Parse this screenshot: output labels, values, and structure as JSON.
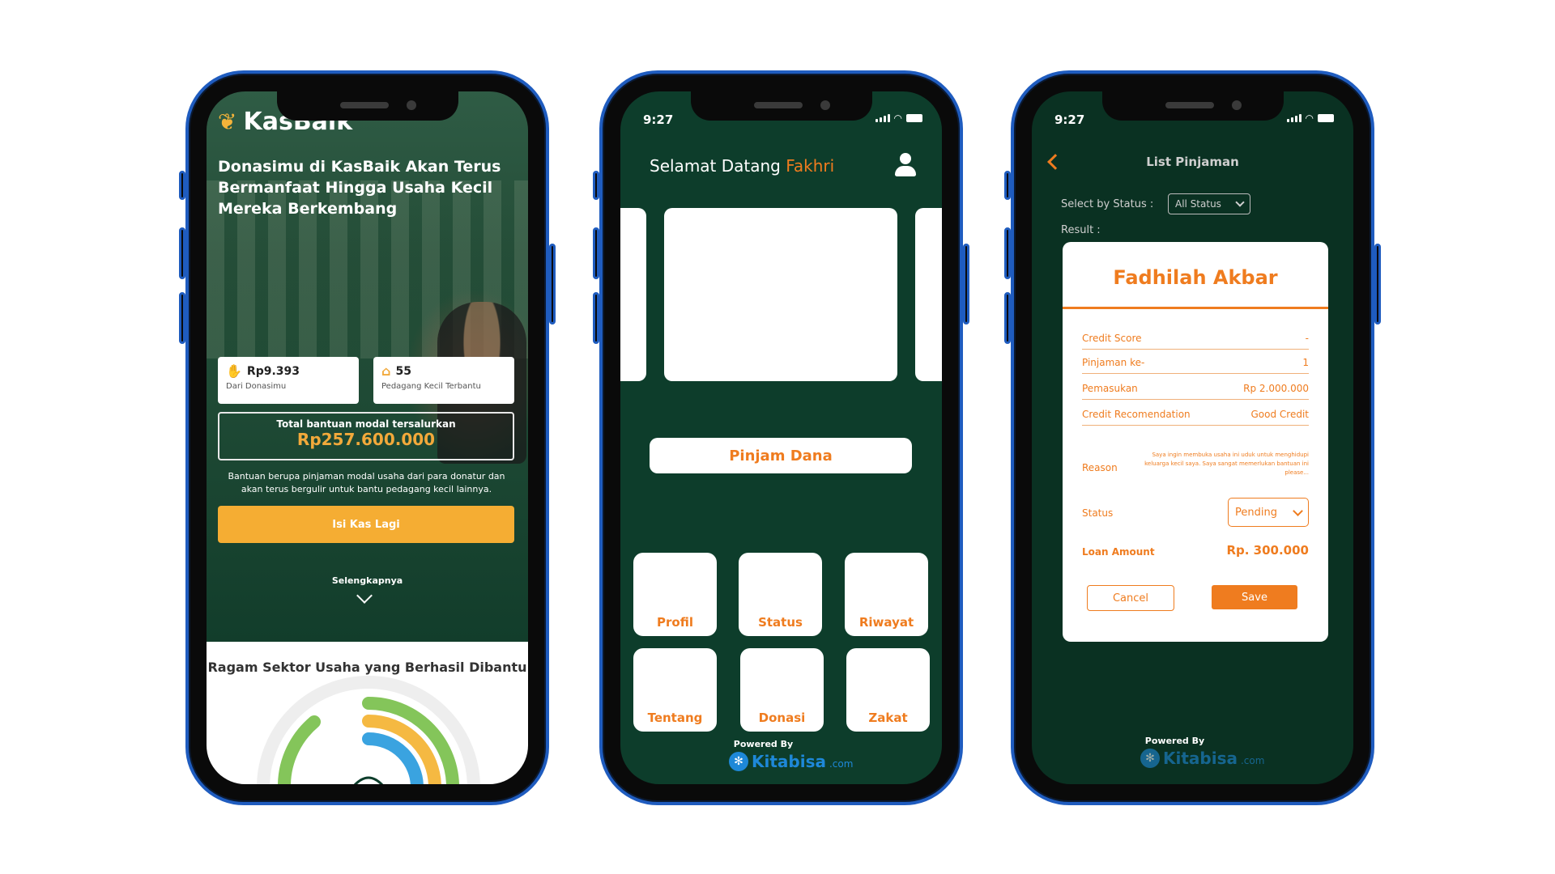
{
  "colors": {
    "brand_green": "#0d3d2b",
    "accent_orange": "#ef7c1f",
    "kasbaik_yellow": "#f5ad33",
    "kitabisa_blue": "#1e88d8",
    "frame_blue": "#1f5cbf"
  },
  "phone1": {
    "logo_text": "KasBaik",
    "logo_icon": "kasbaik-logo-icon",
    "headline": "Donasimu di KasBaik Akan Terus Bermanfaat Hingga Usaha Kecil Mereka Berkembang",
    "stats": [
      {
        "icon": "money-hand-icon",
        "value": "Rp9.393",
        "label": "Dari Donasimu"
      },
      {
        "icon": "shop-icon",
        "value": "55",
        "label": "Pedagang Kecil Terbantu"
      }
    ],
    "total_label": "Total bantuan modal tersalurkan",
    "total_value": "Rp257.600.000",
    "description": "Bantuan berupa pinjaman modal usaha dari para donatur dan akan terus bergulir untuk bantu pedagang kecil lainnya.",
    "cta_label": "Isi Kas Lagi",
    "more_label": "Selengkapnya",
    "sector_title": "Ragam Sektor Usaha yang Berhasil Dibantu"
  },
  "phone2": {
    "time": "9:27",
    "greeting": "Selamat Datang",
    "user_name": "Fakhri",
    "pinjam_label": "Pinjam Dana",
    "menu": [
      "Profil",
      "Status",
      "Riwayat",
      "Tentang",
      "Donasi",
      "Zakat"
    ],
    "powered_by": "Powered By",
    "kitabisa": "Kitabisa",
    "kitabisa_domain": ".com"
  },
  "phone3": {
    "time": "9:27",
    "title": "List Pinjaman",
    "filter_label": "Select by Status :",
    "filter_value": "All Status",
    "result_label": "Result :",
    "name": "Fadhilah Akbar",
    "rows": [
      {
        "label": "Credit Score",
        "value": "-"
      },
      {
        "label": "Pinjaman ke-",
        "value": "1"
      },
      {
        "label": "Pemasukan",
        "value": "Rp 2.000.000"
      },
      {
        "label": "Credit Recomendation",
        "value": "Good Credit"
      }
    ],
    "reason_label": "Reason",
    "reason_text": "Saya ingin membuka usaha ini uduk untuk menghidupi keluarga kecil saya. Saya sangat memerlukan bantuan ini please...",
    "status_label": "Status",
    "status_value": "Pending",
    "loan_label": "Loan Amount",
    "loan_value": "Rp. 300.000",
    "cancel_label": "Cancel",
    "save_label": "Save",
    "powered_by": "Powered By",
    "kitabisa": "Kitabisa",
    "kitabisa_domain": ".com"
  }
}
